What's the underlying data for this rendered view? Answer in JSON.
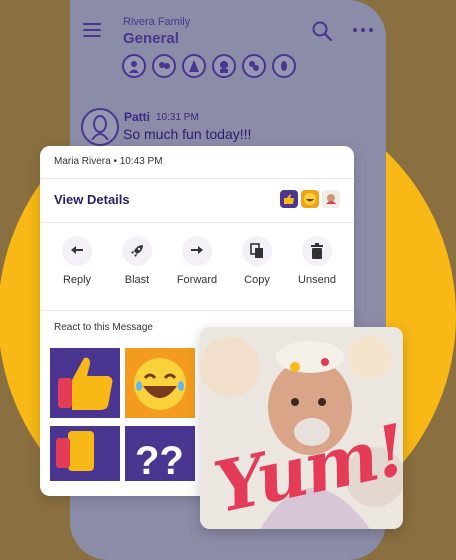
{
  "header": {
    "family_name": "Rivera Family",
    "group_name": "General"
  },
  "chat": {
    "sender": "Patti",
    "time": "10:31 PM",
    "text": "So much fun today!!!"
  },
  "card": {
    "meta": "Maria Rivera • 10:43 PM",
    "view_details": "View Details",
    "actions": [
      {
        "label": "Reply",
        "icon": "reply-icon"
      },
      {
        "label": "Blast",
        "icon": "rocket-icon"
      },
      {
        "label": "Forward",
        "icon": "forward-icon"
      },
      {
        "label": "Copy",
        "icon": "copy-icon"
      },
      {
        "label": "Unsend",
        "icon": "trash-icon"
      }
    ],
    "react_title": "React to this Message"
  },
  "photo": {
    "caption": "Yum!"
  },
  "colors": {
    "brand_purple": "#4a3590",
    "sun_yellow": "#f8b815",
    "phone_gray": "#8b8ca8",
    "yum_red": "#e43c57"
  }
}
